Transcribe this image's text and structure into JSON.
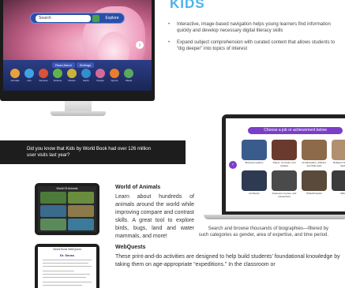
{
  "kids": {
    "title": "KIDS",
    "bullets": [
      "Interactive, image-based navigation helps young learners find information quickly and develop necessary digital literacy skills",
      "Expand subject comprehension with curated content that allows students to “dig deeper” into topics of interest"
    ]
  },
  "kids_screen": {
    "search_placeholder": "Search",
    "explore_label": "Explore",
    "tabs": [
      "Read Aloud",
      "Settings"
    ],
    "icons": [
      {
        "label": "Animals",
        "color": "#e8a23c"
      },
      {
        "label": "Arts",
        "color": "#3fa3e0"
      },
      {
        "label": "Famous",
        "color": "#d9523a"
      },
      {
        "label": "Science",
        "color": "#5fb34a"
      },
      {
        "label": "Places",
        "color": "#c9b13a"
      },
      {
        "label": "Earth",
        "color": "#2f8fcf"
      },
      {
        "label": "People",
        "color": "#d26a9c"
      },
      {
        "label": "Sports",
        "color": "#e87d2f"
      },
      {
        "label": "Plants",
        "color": "#5aa95c"
      }
    ]
  },
  "callout": {
    "text": "Did you know that Kids by World Book had over 126 million user visits last year?"
  },
  "biographies_screen": {
    "banner": "Choose a job or achievement below",
    "cells": [
      {
        "label": "Business leaders",
        "color": "#3a5c8c"
      },
      {
        "label": "Rulers, criminals, and outlaws",
        "color": "#6b3a2e"
      },
      {
        "label": "Ambassadors, athletes, and diplomats",
        "color": "#8c6a4a"
      },
      {
        "label": "Religious figures and leaders",
        "color": "#b09070"
      },
      {
        "label": "Architects",
        "color": "#2e3a52"
      },
      {
        "label": "Dreamers, heroes, and researchers",
        "color": "#4a4a4a"
      },
      {
        "label": "Philanthropists",
        "color": "#5a4a3a"
      },
      {
        "label": "Military",
        "color": "#3c3c3c"
      }
    ],
    "caption": "Search and browse thousands of biographies—filtered by such categories as gender, area of expertise, and time period."
  },
  "world_of_animals": {
    "title": "World of Animals",
    "body": "Learn about hundreds of animals around the world while improving compare and contrast skills. A great tool to explore birds, bugs, land and water mammals, and more!",
    "tablet_title": "World Of Animals",
    "tiles": [
      "#4c7a3a",
      "#6a8c3e",
      "#3a6a8c",
      "#8c7a4a",
      "#5a8a5a",
      "#3a7a9a"
    ]
  },
  "webquests": {
    "title": "WebQuests",
    "body": "These print-and-do activities are designed to help build students’ foundational knowledge by taking them on age-appropriate “expeditions.” In the classroom or",
    "tablet_title": "World Book WebQuest",
    "doc_title": "Dr. Seuss"
  }
}
